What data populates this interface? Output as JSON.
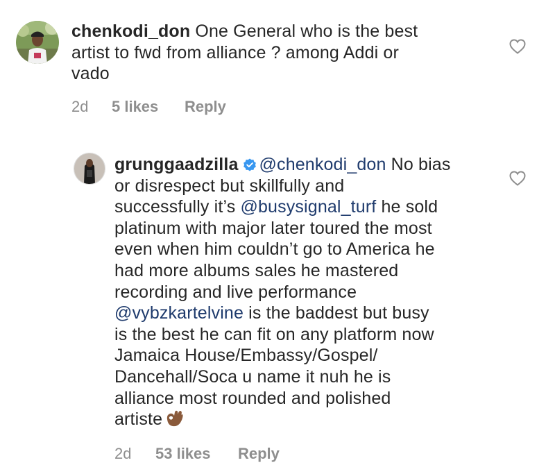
{
  "comments": [
    {
      "username": "chenkodi_don",
      "lines": [
        "One General who is the best",
        "artist to fwd from alliance ? among Addi or",
        "vado"
      ],
      "time": "2d",
      "likes": "5 likes",
      "reply_label": "Reply"
    },
    {
      "username": "grunggaadzilla",
      "verified": true,
      "mention_1": "@chenkodi_don",
      "line1_rest": "No bias",
      "line2": "or disrespect but skillfully and",
      "line3_pre": "successfully it’s ",
      "mention_2": "@busysignal_turf",
      "line3_post": " he sold",
      "line4": "platinum with major later toured the most",
      "line5": "even when him couldn’t go to America he",
      "line6": "had more albums sales he mastered",
      "line7": "recording and live performance",
      "mention_3": "@vybzkartelvine",
      "line8_rest": " is the baddest but busy",
      "line9": "is the best he can fit on any platform now",
      "line10": "Jamaica House/Embassy/Gospel/",
      "line11": "Dancehall/Soca u name it nuh he is",
      "line12": "alliance most rounded and polished",
      "line13": "artiste",
      "emoji": "ok-hand-emoji-dark-skin",
      "time": "2d",
      "likes": "53 likes",
      "reply_label": "Reply"
    }
  ],
  "icons": {
    "like": "heart-outline-icon",
    "verified": "verified-badge-icon"
  },
  "colors": {
    "text": "#262626",
    "meta": "#8e8e8e",
    "mention": "#1f3b6d",
    "verified": "#3897f0"
  }
}
